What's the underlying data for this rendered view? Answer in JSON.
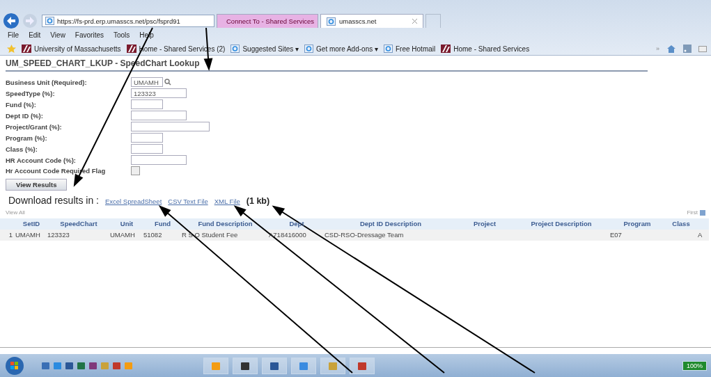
{
  "browser": {
    "address": "https://fs-prd.erp.umasscs.net/psc/fsprd91",
    "tabs": [
      {
        "label": "Connect To - Shared Services",
        "selected": false
      },
      {
        "label": "umasscs.net",
        "selected": true
      }
    ],
    "menu": [
      "File",
      "Edit",
      "View",
      "Favorites",
      "Tools",
      "Help"
    ],
    "favorites": [
      {
        "label": "University of Massachusetts",
        "kind": "site"
      },
      {
        "label": "Home - Shared Services (2)",
        "kind": "site"
      },
      {
        "label": "Suggested Sites ▾",
        "kind": "ie"
      },
      {
        "label": "Get more Add-ons ▾",
        "kind": "ie"
      },
      {
        "label": "Free Hotmail",
        "kind": "ie"
      },
      {
        "label": "Home - Shared Services",
        "kind": "site"
      }
    ],
    "chevron": "»"
  },
  "page": {
    "title": "UM_SPEED_CHART_LKUP - SpeedChart Lookup",
    "fields": [
      {
        "label": "Business Unit (Required):",
        "kind": "lookup",
        "value": "UMAMH"
      },
      {
        "label": "SpeedType (%):",
        "kind": "medium",
        "value": "123323"
      },
      {
        "label": "Fund (%):",
        "kind": "short"
      },
      {
        "label": "Dept ID (%):",
        "kind": "medium"
      },
      {
        "label": "Project/Grant (%):",
        "kind": "long"
      },
      {
        "label": "Program (%):",
        "kind": "short"
      },
      {
        "label": "Class (%):",
        "kind": "short"
      },
      {
        "label": "HR Account Code (%):",
        "kind": "medium"
      },
      {
        "label": "Hr Account Code Required Flag",
        "kind": "checkbox",
        "checked": false
      }
    ],
    "button": "View Results",
    "download": {
      "label": "Download results in :",
      "links": [
        "Excel SpreadSheet",
        "CSV Text File",
        "XML File"
      ],
      "size": "(1 kb)"
    },
    "view_all": "View All",
    "first": "First",
    "table": {
      "columns": [
        "SetID",
        "SpeedChart",
        "Unit",
        "Fund",
        "Fund Description",
        "Dept",
        "Dept ID Description",
        "Project",
        "Project Description",
        "Program",
        "Class"
      ],
      "rows": [
        {
          "number": "1",
          "cells": [
            "UMAMH",
            "123323",
            "UMAMH",
            "51082",
            "R S O Student Fee",
            "A718416000",
            "CSD-RSO-Dressage Team",
            "",
            "",
            "E07",
            "",
            "A"
          ]
        }
      ]
    }
  },
  "taskbar": {
    "battery": "100%"
  }
}
